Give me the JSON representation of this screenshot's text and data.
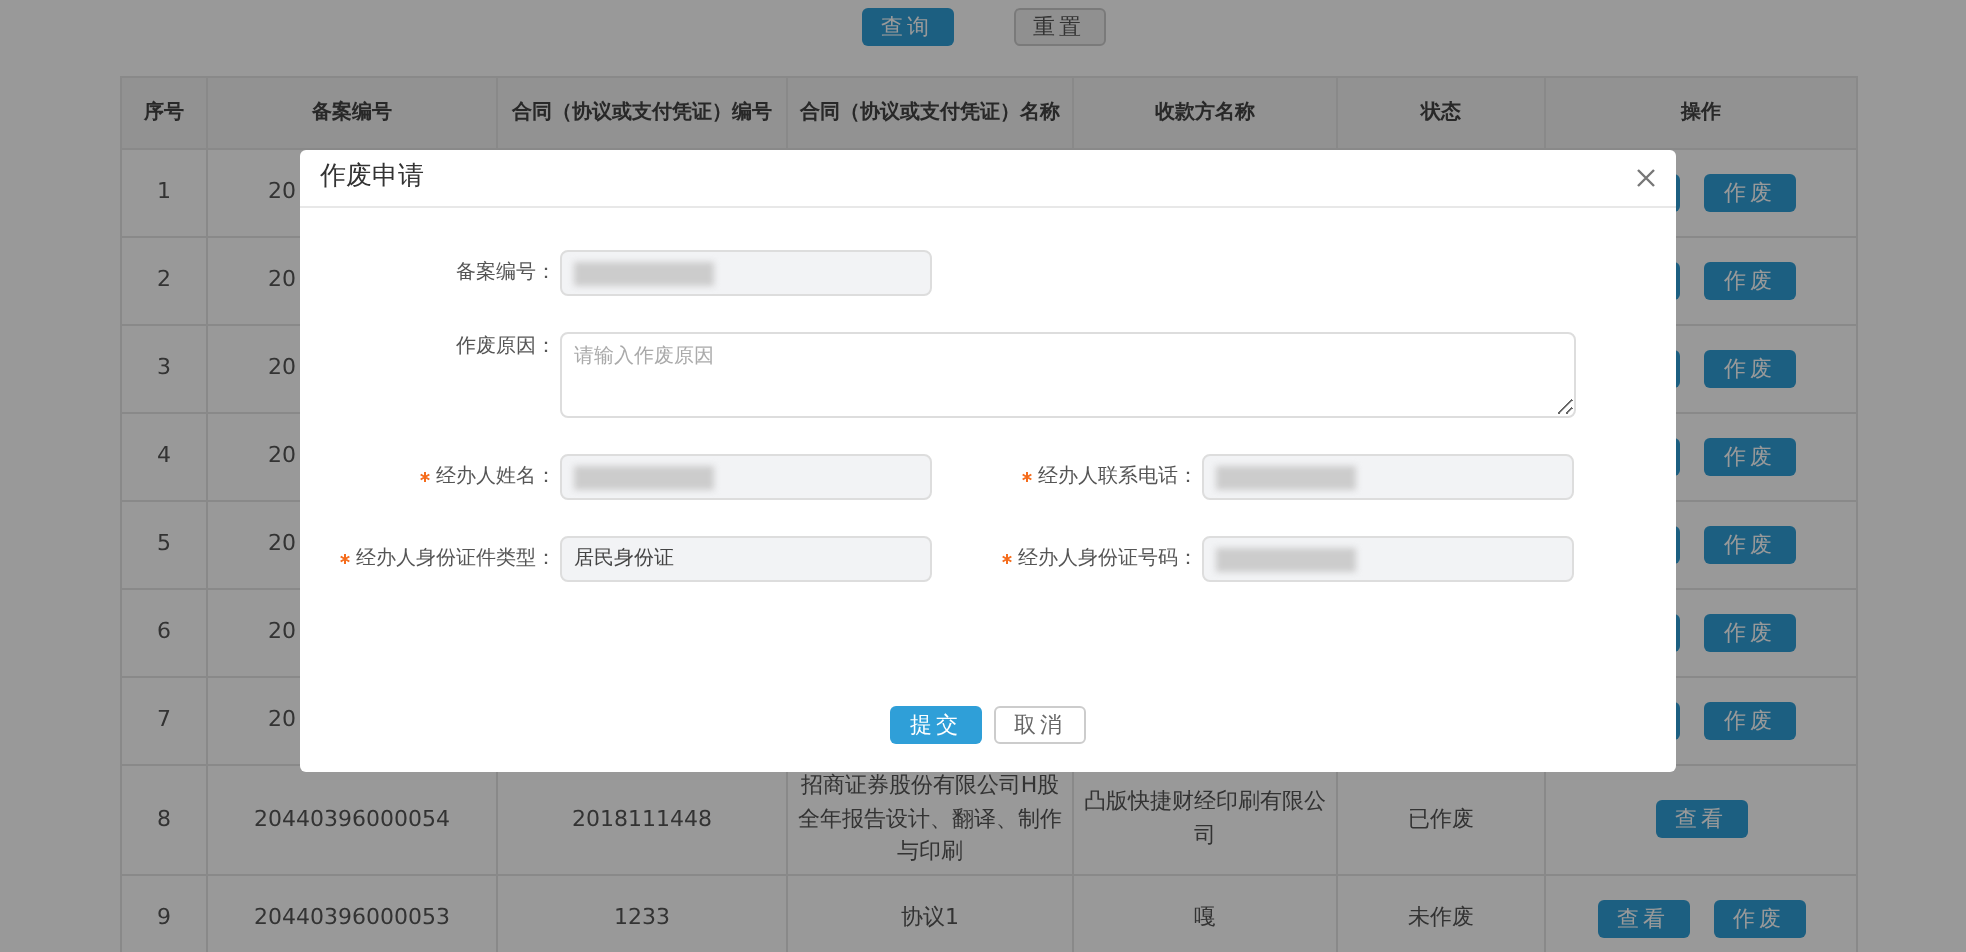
{
  "toolbar": {
    "buttons": [
      {
        "label": "查询",
        "kind": "primary"
      },
      {
        "label": "重置",
        "kind": "secondary"
      }
    ]
  },
  "table": {
    "columns": [
      "序号",
      "备案编号",
      "合同（协议或支付凭证）编号",
      "合同（协议或支付凭证）名称",
      "收款方名称",
      "状态",
      "操作"
    ],
    "rows": [
      {
        "cells": [
          "1",
          "20"
        ],
        "buttons": [
          {
            "kind": "covered"
          },
          {
            "kind": "action",
            "label": "作废"
          }
        ]
      },
      {
        "cells": [
          "2",
          "20"
        ],
        "buttons": [
          {
            "kind": "covered"
          },
          {
            "kind": "action",
            "label": "作废"
          }
        ]
      },
      {
        "cells": [
          "3",
          "20"
        ],
        "buttons": [
          {
            "kind": "covered"
          },
          {
            "kind": "action",
            "label": "作废"
          }
        ]
      },
      {
        "cells": [
          "4",
          "20"
        ],
        "buttons": [
          {
            "kind": "covered"
          },
          {
            "kind": "action",
            "label": "作废"
          }
        ]
      },
      {
        "cells": [
          "5",
          "20"
        ],
        "buttons": [
          {
            "kind": "covered"
          },
          {
            "kind": "action",
            "label": "作废"
          }
        ]
      },
      {
        "cells": [
          "6",
          "20"
        ],
        "buttons": [
          {
            "kind": "covered"
          },
          {
            "kind": "action",
            "label": "作废"
          }
        ]
      },
      {
        "cells": [
          "7",
          "20"
        ],
        "buttons": [
          {
            "kind": "covered"
          },
          {
            "kind": "action",
            "label": "作废"
          }
        ]
      },
      {
        "cells": [
          "8",
          "20440396000054",
          "2018111448",
          "招商证券股份有限公司H股全年报告设计、翻译、制作与印刷",
          "凸版快捷财经印刷有限公司",
          "已作废"
        ],
        "buttons": [
          {
            "kind": "action",
            "label": "查看"
          }
        ]
      },
      {
        "cells": [
          "9",
          "20440396000053",
          "1233",
          "协议1",
          "嘎",
          "未作废"
        ],
        "buttons": [
          {
            "kind": "action",
            "label": "查看"
          },
          {
            "kind": "action",
            "label": "作废"
          }
        ]
      }
    ]
  },
  "modal": {
    "title": "作废申请",
    "rows": [
      [
        {
          "label": "备案编号：",
          "kind": "input",
          "required": false,
          "redacted": true
        }
      ],
      [
        {
          "label": "作废原因：",
          "kind": "textarea",
          "required": false,
          "placeholder": "请输入作废原因"
        }
      ],
      [
        {
          "label": "经办人姓名：",
          "kind": "input",
          "required": true,
          "redacted": true
        },
        {
          "label": "经办人联系电话：",
          "kind": "input",
          "required": true,
          "redacted": true
        }
      ],
      [
        {
          "label": "经办人身份证件类型：",
          "kind": "input",
          "required": true,
          "value": "居民身份证"
        },
        {
          "label": "经办人身份证号码：",
          "kind": "input",
          "required": true,
          "redacted": true
        }
      ]
    ],
    "buttons": [
      {
        "label": "提交",
        "kind": "primary"
      },
      {
        "label": "取消",
        "kind": "default"
      }
    ]
  }
}
